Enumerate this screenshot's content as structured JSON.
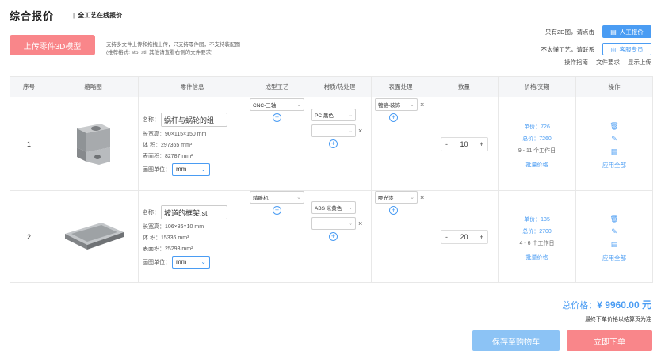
{
  "header": {
    "title": "综合报价",
    "subtitle": "全工艺在线报价",
    "upload_label": "上传零件3D模型",
    "upload_hint1": "支持多文件上传和拖拽上传，只支持零件图，不支持装配图",
    "upload_hint2": "(推荐格式: stp, stl, 其他请查看右侧的文件要求)",
    "manual_text": "只有2D图，请点击",
    "manual_btn": "人工报价",
    "service_text": "不太懂工艺，请联系",
    "service_btn": "客服专员",
    "link_guide": "操作指南",
    "link_file": "文件要求",
    "link_show": "显示上传"
  },
  "table": {
    "headers": [
      "序号",
      "缩略图",
      "零件信息",
      "成型工艺",
      "材质/热处理",
      "表面处理",
      "数量",
      "价格/交期",
      "操作"
    ],
    "labels": {
      "name": "名称：",
      "size": "长宽高：",
      "volume": "体 积：",
      "area": "表面积：",
      "unit": "画图单位："
    },
    "rows": [
      {
        "seq": "1",
        "name": "蜗杆与蜗轮的组",
        "size": "90×115×150 mm",
        "volume": "297365 mm³",
        "area": "82787 mm²",
        "unit": "mm",
        "process": "CNC-三轴",
        "material": "PC 黑色",
        "material2": "",
        "surface": "镀铬-装饰",
        "qty": "10",
        "unit_price": "单价：726",
        "total_price": "总价：7260",
        "lead": "9 - 11 个工作日",
        "batch": "批量价格",
        "apply": "应用全部"
      },
      {
        "seq": "2",
        "name": "坡道的框架.stl",
        "size": "106×86×10 mm",
        "volume": "15336 mm³",
        "area": "25293 mm²",
        "unit": "mm",
        "process": "精雕机",
        "material": "ABS 米黄色",
        "material2": "",
        "surface": "哑光漆",
        "qty": "20",
        "unit_price": "单价：135",
        "total_price": "总价：2700",
        "lead": "4 - 6 个工作日",
        "batch": "批量价格",
        "apply": "应用全部"
      }
    ]
  },
  "footer": {
    "total_label": "总价格：",
    "total_value": "¥ 9960.00 元",
    "note": "最终下单价格以结算页为准",
    "cart_btn": "保存至购物车",
    "order_btn": "立即下单"
  },
  "colors": {
    "accent": "#4a9cf3",
    "brand_pink": "#f9868a"
  }
}
